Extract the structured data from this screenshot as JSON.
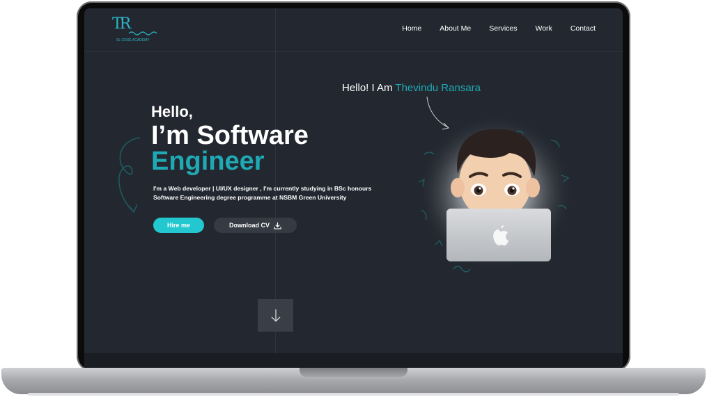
{
  "logo": {
    "mark": "TR",
    "caption": "SL CODE ACADEMY"
  },
  "nav": {
    "items": [
      "Home",
      "About Me",
      "Services",
      "Work",
      "Contact"
    ]
  },
  "hero": {
    "hello": "Hello,",
    "line2": "I’m Software",
    "line3": "Engineer",
    "description": "I'm a Web developer | UI/UX designer , I'm currently studying in BSc honours Software Engineering degree programme at NSBM Green University",
    "hire_label": "Hire me",
    "cv_label": "Download CV"
  },
  "greeting": {
    "prefix": "Hello! I Am ",
    "name": "Thevindu Ransara"
  },
  "icons": {
    "download": "download-icon",
    "scroll": "arrow-down-icon",
    "laptop_logo": "apple-logo-icon"
  },
  "colors": {
    "accent": "#1fa9b4",
    "button": "#22c7cf",
    "background": "#232830"
  }
}
